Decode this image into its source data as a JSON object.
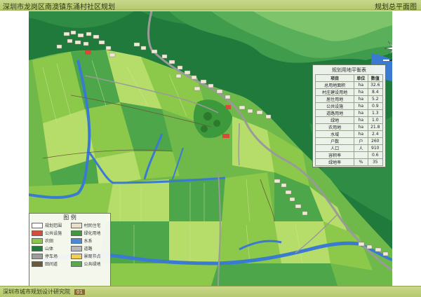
{
  "header": {
    "title": "深圳市龙岗区南澳镇东涌村社区规划",
    "sheet": "规划总平面图"
  },
  "footer": {
    "org": "深圳市城市规划设计研究院",
    "tag": "01"
  },
  "indicator_table": {
    "title": "规划用地平衡表",
    "headers": [
      "项目",
      "单位",
      "数值"
    ],
    "rows": [
      [
        "总用地面积",
        "ha",
        "32.6"
      ],
      [
        "村庄建设用地",
        "ha",
        "8.4"
      ],
      [
        "居住用地",
        "ha",
        "5.2"
      ],
      [
        "公共设施",
        "ha",
        "0.9"
      ],
      [
        "道路用地",
        "ha",
        "1.3"
      ],
      [
        "绿地",
        "ha",
        "1.0"
      ],
      [
        "农用地",
        "ha",
        "21.8"
      ],
      [
        "水域",
        "ha",
        "2.4"
      ],
      [
        "户数",
        "户",
        "260"
      ],
      [
        "人口",
        "人",
        "910"
      ],
      [
        "容积率",
        "",
        "0.6"
      ],
      [
        "绿地率",
        "%",
        "35"
      ]
    ]
  },
  "legend": {
    "title": "图 例",
    "items": [
      {
        "label": "规划范围",
        "color": "#ffffff"
      },
      {
        "label": "村民住宅",
        "color": "#e8e0c8"
      },
      {
        "label": "公共设施",
        "color": "#d94a3a"
      },
      {
        "label": "绿化用地",
        "color": "#3c9a3c"
      },
      {
        "label": "农田",
        "color": "#8cc84a"
      },
      {
        "label": "水系",
        "color": "#4a8ad8"
      },
      {
        "label": "山体",
        "color": "#1f7a3c"
      },
      {
        "label": "道路",
        "color": "#b8b8b8"
      },
      {
        "label": "停车场",
        "color": "#9c9c9c"
      },
      {
        "label": "景观节点",
        "color": "#f0d050"
      },
      {
        "label": "田间道",
        "color": "#6a5a3a"
      },
      {
        "label": "公共绿地",
        "color": "#5aaa4a"
      }
    ]
  },
  "colors": {
    "mountain_dark": "#1f7a3c",
    "mountain_light": "#7ec46a",
    "farmland_a": "#8cc84a",
    "farmland_b": "#b6dc6a",
    "farmland_c": "#4ea64a",
    "water": "#3a7ad0",
    "road": "#9a9a9a",
    "village": "#efe9d6"
  },
  "icons": {
    "compass": "north-arrow-icon"
  }
}
